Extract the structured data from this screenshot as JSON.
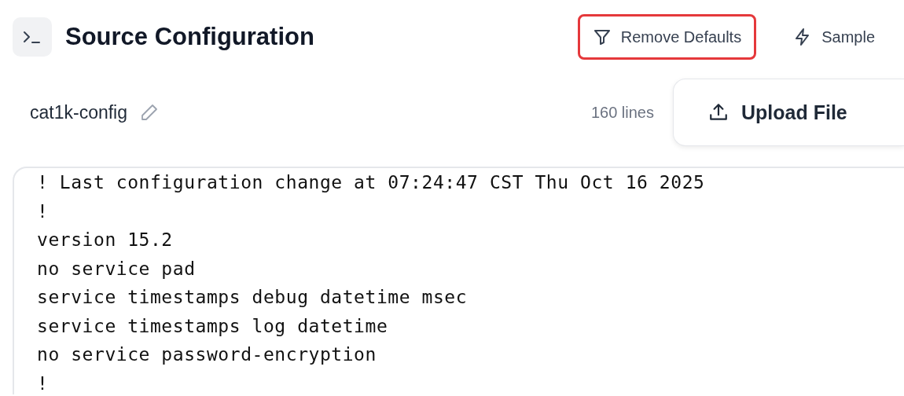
{
  "header": {
    "title": "Source Configuration",
    "actions": [
      {
        "kind": "filter",
        "label": "Remove Defaults",
        "highlighted": true
      },
      {
        "kind": "bolt",
        "label": "Sample",
        "highlighted": false
      }
    ]
  },
  "file": {
    "name": "cat1k-config",
    "line_count": "160 lines",
    "upload_label": "Upload File"
  },
  "editor": {
    "lines": [
      "! Last configuration change at 07:24:47 CST Thu Oct 16 2025",
      "!",
      "version 15.2",
      "no service pad",
      "service timestamps debug datetime msec",
      "service timestamps log datetime",
      "no service password-encryption",
      "!"
    ]
  }
}
